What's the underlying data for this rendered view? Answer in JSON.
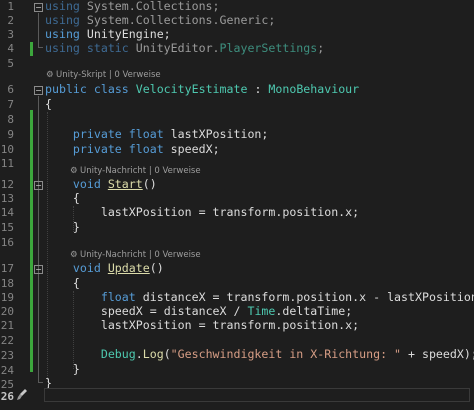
{
  "editor": {
    "line_numbers": [
      "1",
      "2",
      "3",
      "4",
      "5",
      "6",
      "7",
      "8",
      "9",
      "10",
      "11",
      "12",
      "13",
      "14",
      "15",
      "16",
      "17",
      "18",
      "19",
      "20",
      "21",
      "22",
      "23",
      "24",
      "25",
      "26"
    ],
    "active_line": "26",
    "codelens": {
      "class_lens": "Unity-Skript | 0 Verweise",
      "start_lens": "Unity-Nachricht | 0 Verweise",
      "update_lens": "Unity-Nachricht | 0 Verweise"
    },
    "tokens": {
      "using": "using",
      "static": "static",
      "ns_system_collections": "System.Collections",
      "ns_system_collections_generic": "System.Collections.Generic",
      "ns_unity_engine": "UnityEngine",
      "ns_unity_editor": "UnityEditor",
      "player_settings": "PlayerSettings",
      "public": "public",
      "class": "class",
      "class_name": "VelocityEstimate",
      "colon": ":",
      "mono_behaviour": "MonoBehaviour",
      "open_brace": "{",
      "close_brace": "}",
      "private": "private",
      "float": "float",
      "void": "void",
      "last_x_position": "lastXPosition",
      "speed_x": "speedX",
      "distance_x": "distanceX",
      "start": "Start",
      "update": "Update",
      "parens": "()",
      "semicolon": ";",
      "dot": ".",
      "transform_position_x": "transform.position.x",
      "equals": "=",
      "minus": "-",
      "slash": "/",
      "time": "Time",
      "delta_time": "deltaTime",
      "debug": "Debug",
      "log": "Log",
      "paren_open": "(",
      "paren_close": ")",
      "plus": "+",
      "log_string": "\"Geschwindigkeit in X-Richtung: \""
    }
  },
  "colors": {
    "background": "#1e1e1e",
    "keyword": "#569cd6",
    "type": "#4ec9b0",
    "method": "#dcdcaa",
    "string": "#d69d85",
    "text": "#dcdcdc",
    "change_bar": "#3ca63c",
    "line_number": "#858585"
  },
  "icons": {
    "codelens_icon": "unity-cube-icon",
    "fold_icon": "collapse-minus-icon",
    "gutter_icon": "quick-action-brush-icon"
  }
}
